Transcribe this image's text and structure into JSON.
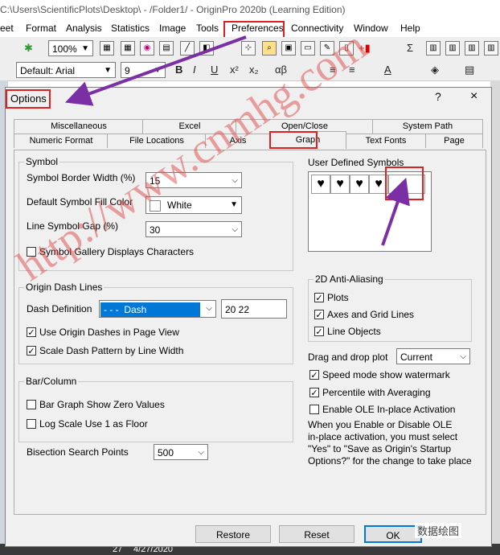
{
  "window": {
    "title": "C:\\Users\\ScientificPlots\\Desktop\\ - /Folder1/ - OriginPro 2020b (Learning Edition)"
  },
  "menu": [
    "eet",
    "Format",
    "Analysis",
    "Statistics",
    "Image",
    "Tools",
    "Preferences",
    "Connectivity",
    "Window",
    "Help"
  ],
  "toolbar": {
    "zoom": "100%",
    "font": "Default: Arial",
    "font_size": "9",
    "bold": "B",
    "italic": "I",
    "underline": "U",
    "greek": "αβ",
    "superscript": "x²",
    "subscript": "x₂"
  },
  "dialog": {
    "title": "Options",
    "help": "?",
    "close": "×",
    "tabs_back": [
      "Miscellaneous",
      "Excel",
      "Open/Close",
      "System Path"
    ],
    "tabs_front": [
      "Numeric Format",
      "File Locations",
      "Axis",
      "Graph",
      "Text Fonts",
      "Page"
    ],
    "symbol": {
      "title": "Symbol",
      "border_width_label": "Symbol Border Width (%)",
      "border_width_value": "15",
      "fill_color_label": "Default Symbol Fill Color",
      "fill_color_value": "White",
      "gap_label": "Line Symbol Gap (%)",
      "gap_value": "30",
      "gallery_label": "Symbol Gallery Displays Characters"
    },
    "user_symbols": {
      "title": "User Defined Symbols",
      "symbols": [
        "♥",
        "♥",
        "♥",
        "♥",
        ""
      ]
    },
    "dash": {
      "title": "Origin Dash Lines",
      "definition_label": "Dash Definition",
      "definition_pattern": "- - -",
      "definition_value": "Dash",
      "pattern_value": "20 22",
      "use_origin_dashes": "Use Origin Dashes in Page View",
      "scale_dash": "Scale Dash Pattern by Line Width"
    },
    "anti_alias": {
      "title": "2D Anti-Aliasing",
      "plots": "Plots",
      "axes": "Axes and Grid Lines",
      "line_objects": "Line Objects"
    },
    "drag_drop": {
      "label": "Drag and drop plot",
      "value": "Current"
    },
    "speed_mode": "Speed mode show watermark",
    "percentile": "Percentile with Averaging",
    "ole": "Enable OLE In-place Activation",
    "ole_note": [
      "When you Enable or Disable OLE",
      "in-place activation, you must select",
      "\"Yes\" to \"Save as Origin's Startup",
      "Options?\" for the change to take place"
    ],
    "bar": {
      "title": "Bar/Column",
      "zero_values": "Bar Graph Show Zero Values",
      "log_scale": "Log Scale Use 1 as Floor"
    },
    "bisection": {
      "label": "Bisection Search Points",
      "value": "500"
    },
    "buttons": {
      "restore": "Restore",
      "reset": "Reset",
      "ok": "OK"
    }
  },
  "background": {
    "row_number": "27",
    "date": "4/27/2020"
  },
  "watermark": "http://www.cnmhg.com",
  "brand": "数据绘图",
  "colors": {
    "highlight": "#e02020",
    "arrow": "#7b2fa5",
    "selection": "#0078d7",
    "watermark": "#e04b4b"
  }
}
